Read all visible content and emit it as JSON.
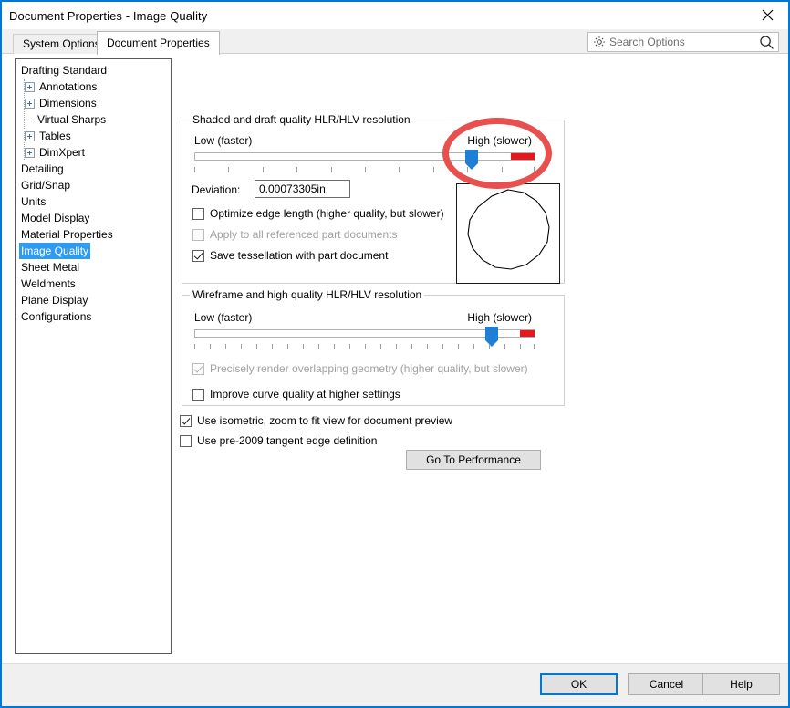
{
  "window": {
    "title": "Document Properties - Image Quality",
    "close_icon": "close-icon"
  },
  "tabs": [
    {
      "label": "System Options",
      "active": false
    },
    {
      "label": "Document Properties",
      "active": true
    }
  ],
  "search": {
    "placeholder": "Search Options",
    "value": "",
    "gear_icon": "gear-icon",
    "magnifier_icon": "search-icon"
  },
  "sidebar": {
    "items": [
      {
        "label": "Drafting Standard",
        "level": 0,
        "expander": "none",
        "selected": false
      },
      {
        "label": "Annotations",
        "level": 1,
        "expander": "plus",
        "selected": false
      },
      {
        "label": "Dimensions",
        "level": 1,
        "expander": "plus",
        "selected": false
      },
      {
        "label": "Virtual Sharps",
        "level": 1,
        "expander": "dots",
        "selected": false
      },
      {
        "label": "Tables",
        "level": 1,
        "expander": "plus",
        "selected": false
      },
      {
        "label": "DimXpert",
        "level": 1,
        "expander": "plus",
        "selected": false
      },
      {
        "label": "Detailing",
        "level": 0,
        "expander": "none",
        "selected": false
      },
      {
        "label": "Grid/Snap",
        "level": 0,
        "expander": "none",
        "selected": false
      },
      {
        "label": "Units",
        "level": 0,
        "expander": "none",
        "selected": false
      },
      {
        "label": "Model Display",
        "level": 0,
        "expander": "none",
        "selected": false
      },
      {
        "label": "Material Properties",
        "level": 0,
        "expander": "none",
        "selected": false
      },
      {
        "label": "Image Quality",
        "level": 0,
        "expander": "none",
        "selected": true
      },
      {
        "label": "Sheet Metal",
        "level": 0,
        "expander": "none",
        "selected": false
      },
      {
        "label": "Weldments",
        "level": 0,
        "expander": "none",
        "selected": false
      },
      {
        "label": "Plane Display",
        "level": 0,
        "expander": "none",
        "selected": false
      },
      {
        "label": "Configurations",
        "level": 0,
        "expander": "none",
        "selected": false
      }
    ]
  },
  "shaded_group": {
    "title": "Shaded and draft quality HLR/HLV resolution",
    "slider": {
      "low_label": "Low (faster)",
      "high_label": "High (slower)",
      "value_percent": 84,
      "red_zone_start_percent": 93,
      "tick_count": 11,
      "thumb_color": "#1f7fd4",
      "red_color": "#e8161d"
    },
    "deviation_label": "Deviation:",
    "deviation_value": "0.00073305in",
    "checkboxes": [
      {
        "label": "Optimize edge length (higher quality, but slower)",
        "checked": false,
        "disabled": false
      },
      {
        "label": "Apply to all referenced part documents",
        "checked": false,
        "disabled": true
      },
      {
        "label": "Save tessellation with part document",
        "checked": true,
        "disabled": false
      }
    ],
    "preview_name": "circle-preview"
  },
  "wireframe_group": {
    "title": "Wireframe and high quality HLR/HLV resolution",
    "slider": {
      "low_label": "Low (faster)",
      "high_label": "High (slower)",
      "value_percent": 89,
      "red_zone_start_percent": 96,
      "tick_count": 23,
      "thumb_color": "#1f7fd4",
      "red_color": "#e8161d"
    },
    "checkboxes": [
      {
        "label": "Precisely render overlapping geometry (higher quality, but slower)",
        "checked": true,
        "disabled": true
      },
      {
        "label": "Improve curve quality at higher settings",
        "checked": false,
        "disabled": false
      }
    ]
  },
  "bottom_options": {
    "checkboxes": [
      {
        "label": "Use isometric, zoom to fit view for document preview",
        "checked": true,
        "disabled": false
      },
      {
        "label": "Use pre-2009 tangent edge definition",
        "checked": false,
        "disabled": false
      }
    ],
    "performance_button": "Go To Performance"
  },
  "footer": {
    "ok": "OK",
    "cancel": "Cancel",
    "help": "Help"
  },
  "annotation": {
    "shape": "ellipse",
    "color": "#e8504f"
  }
}
